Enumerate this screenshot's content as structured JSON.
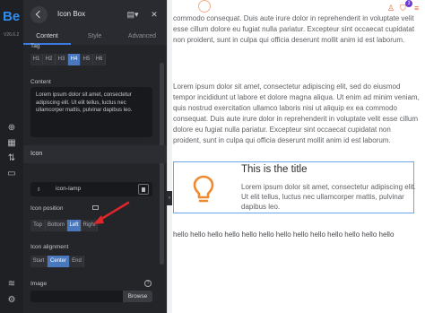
{
  "rail": {
    "logo": "Be",
    "version": "V26.6.2"
  },
  "panel": {
    "title": "Icon Box",
    "tabs": [
      {
        "label": "Content"
      },
      {
        "label": "Style"
      },
      {
        "label": "Advanced"
      }
    ],
    "active_tab": "Content",
    "tag": {
      "label": "Tag",
      "options": [
        "H1",
        "H2",
        "H3",
        "H4",
        "H5",
        "H6"
      ],
      "selected": "H4"
    },
    "content": {
      "label": "Content",
      "value": "Lorem ipsum dolor sit amet, consectetur adipiscing elit. Ut elit tellus, luctus nec ullamcorper mattis, pulvinar dapibus leo."
    },
    "icon_section": {
      "label": "Icon"
    },
    "icon_field": {
      "value": "icon-lamp"
    },
    "icon_position": {
      "label": "Icon position",
      "options": [
        "Top",
        "Bottom",
        "Left",
        "Right"
      ],
      "selected": "Left"
    },
    "icon_alignment": {
      "label": "Icon alignment",
      "options": [
        "Start",
        "Center",
        "End"
      ],
      "selected": "Center"
    },
    "image": {
      "label": "Image",
      "browse_label": "Browse"
    }
  },
  "canvas": {
    "paragraph_1": "commodo consequat. Duis aute irure dolor in reprehenderit in voluptate velit esse cillum dolore eu fugiat nulla pariatur. Excepteur sint occaecat cupidatat non proident, sunt in culpa qui officia deserunt mollit anim id est laborum.",
    "paragraph_2": "Lorem ipsum dolor sit amet, consectetur adipiscing elit, sed do eiusmod tempor incididunt ut labore et dolore magna aliqua. Ut enim ad minim veniam, quis nostrud exercitation ullamco laboris nisi ut aliquip ex ea commodo consequat. Duis aute irure dolor in reprehenderit in voluptate velit esse cillum dolore eu fugiat nulla pariatur. Excepteur sint occaecat cupidatat non proident, sunt in culpa qui officia deserunt mollit anim id est laborum.",
    "iconbox": {
      "title": "This is the title",
      "text": "Lorem ipsum dolor sit amet, consectetur adipiscing elit. Ut elit tellus, luctus nec ullamcorper mattis, pulvinar dapibus leo.",
      "icon": "lightbulb-icon",
      "icon_color": "#f08a2c"
    },
    "hello_text": "hello hello hello hello hello hello hello hello hello hello hello hello hello",
    "cart_count": "3"
  },
  "colors": {
    "accent": "#4a78be",
    "panel_bg": "#242529",
    "arrow": "#e0262b",
    "selection_outline": "#6aa5f0"
  }
}
